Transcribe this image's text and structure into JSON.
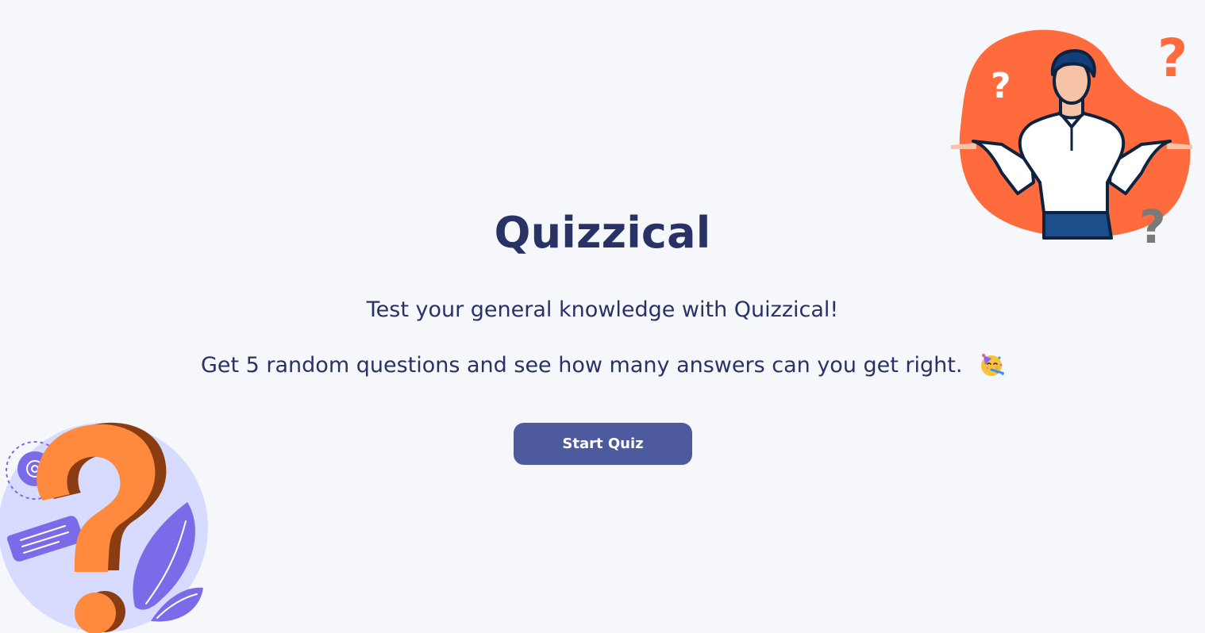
{
  "app": {
    "title": "Quizzical"
  },
  "intro": {
    "line1": "Test your general knowledge with Quizzical!",
    "line2": "Get 5 random questions and see how many answers can you get right."
  },
  "actions": {
    "start_label": "Start Quiz"
  },
  "icons": {
    "celebration": "partying-face-icon",
    "person": "confused-person-illustration",
    "question": "question-mark-illustration"
  },
  "colors": {
    "background": "#F5F7FB",
    "text": "#293264",
    "button": "#4D5B9E",
    "accent_orange": "#FF6B3D",
    "accent_purple": "#7B6BE8",
    "accent_lavender": "#D6DBFF"
  }
}
